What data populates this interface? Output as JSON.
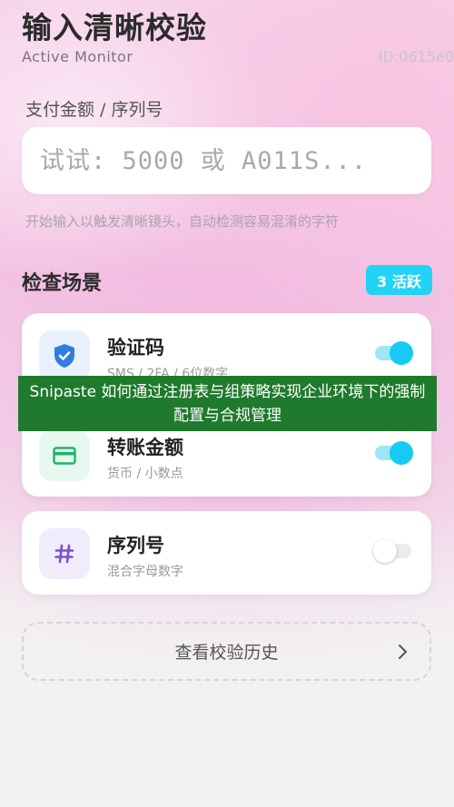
{
  "header": {
    "title": "输入清晰校验",
    "subtitle": "Active Monitor",
    "id_label": "ID:0615e0"
  },
  "input": {
    "label": "支付金额 / 序列号",
    "placeholder": "试试: 5000 或 A011S...",
    "value": "",
    "hint": "开始输入以触发清晰镜头，自动检测容易混淆的字符"
  },
  "scenes": {
    "title": "检查场景",
    "badge": "3 活跃",
    "items": [
      {
        "title": "验证码",
        "desc": "SMS / 2FA / 6位数字",
        "icon": "shield-check-icon",
        "icon_color": "#2f7de1",
        "icon_bg": "#e8f1fd",
        "enabled": true
      },
      {
        "title": "转账金额",
        "desc": "货币 / 小数点",
        "icon": "card-icon",
        "icon_color": "#1fb36c",
        "icon_bg": "#e6f8ef",
        "enabled": true
      },
      {
        "title": "序列号",
        "desc": "混合字母数字",
        "icon": "hash-icon",
        "icon_color": "#7b4fd1",
        "icon_bg": "#f1ecfb",
        "enabled": false
      }
    ]
  },
  "history_button": {
    "label": "查看校验历史",
    "icon": "chevron-right-icon"
  },
  "banner": {
    "text": "Snipaste 如何通过注册表与组策略实现企业环境下的强制配置与合规管理"
  },
  "colors": {
    "accent": "#16cbf3",
    "banner_bg": "#1f7a2d"
  }
}
